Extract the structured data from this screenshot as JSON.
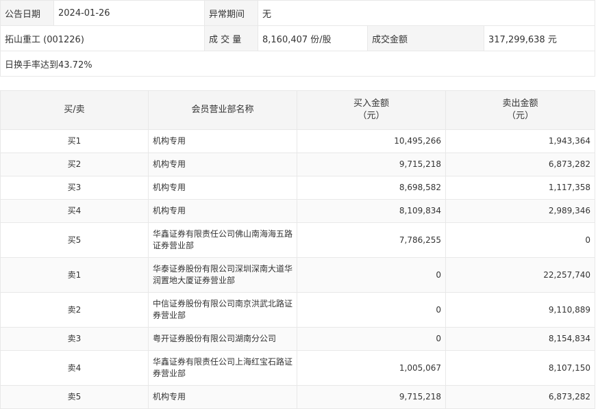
{
  "info": {
    "announce_date_label": "公告日期",
    "announce_date": "2024-01-26",
    "abnormal_period_label": "异常期间",
    "abnormal_period": "无",
    "stock": "拓山重工 (001226)",
    "volume_label": "成 交 量",
    "volume": "8,160,407 份/股",
    "amount_label": "成交金额",
    "amount": "317,299,638 元",
    "reason": "日换手率达到43.72%"
  },
  "table": {
    "headers": {
      "side": "买/卖",
      "broker": "会员营业部名称",
      "buy_l1": "买入金额",
      "buy_l2": "（元）",
      "sell_l1": "卖出金额",
      "sell_l2": "（元）"
    },
    "rows": [
      {
        "side": "买1",
        "broker": "机构专用",
        "buy": "10,495,266",
        "sell": "1,943,364"
      },
      {
        "side": "买2",
        "broker": "机构专用",
        "buy": "9,715,218",
        "sell": "6,873,282"
      },
      {
        "side": "买3",
        "broker": "机构专用",
        "buy": "8,698,582",
        "sell": "1,117,358"
      },
      {
        "side": "买4",
        "broker": "机构专用",
        "buy": "8,109,834",
        "sell": "2,989,346"
      },
      {
        "side": "买5",
        "broker": "华鑫证券有限责任公司佛山南海海五路证券营业部",
        "buy": "7,786,255",
        "sell": "0"
      },
      {
        "side": "卖1",
        "broker": "华泰证券股份有限公司深圳深南大道华润置地大厦证券营业部",
        "buy": "0",
        "sell": "22,257,740"
      },
      {
        "side": "卖2",
        "broker": "中信证券股份有限公司南京洪武北路证券营业部",
        "buy": "0",
        "sell": "9,110,889"
      },
      {
        "side": "卖3",
        "broker": "粤开证券股份有限公司湖南分公司",
        "buy": "0",
        "sell": "8,154,834"
      },
      {
        "side": "卖4",
        "broker": "华鑫证券有限责任公司上海红宝石路证券营业部",
        "buy": "1,005,067",
        "sell": "8,107,150"
      },
      {
        "side": "卖5",
        "broker": "机构专用",
        "buy": "9,715,218",
        "sell": "6,873,282"
      }
    ]
  }
}
